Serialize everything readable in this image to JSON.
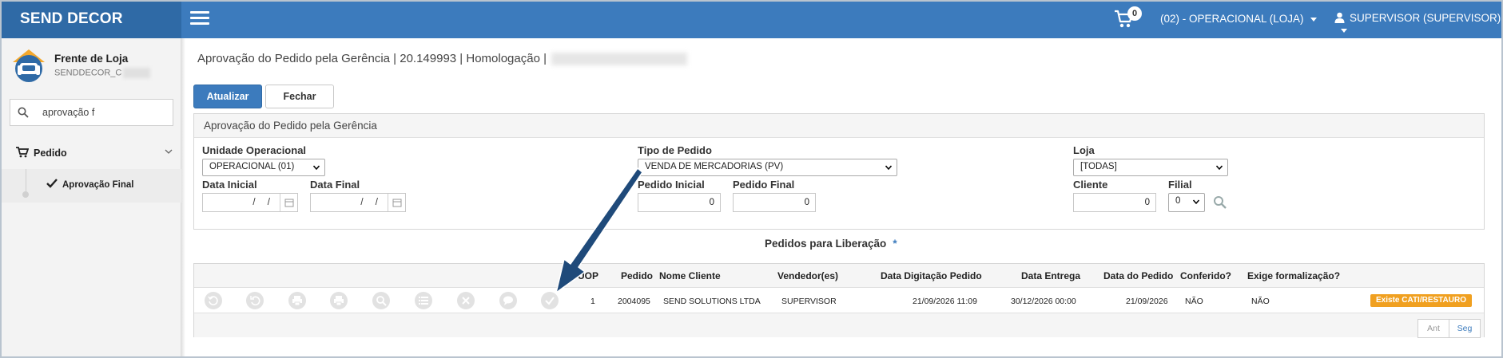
{
  "app": {
    "brand": "SEND DECOR"
  },
  "header": {
    "cart_count": "0",
    "store_selector": "(02) - OPERACIONAL (LOJA)",
    "user_menu": "SUPERVISOR (SUPERVISOR)"
  },
  "sidebar": {
    "profile_name": "Frente de Loja",
    "profile_sub": "SENDDECOR_C",
    "search_value": "aprovação f",
    "group_label": "Pedido",
    "item_label": "Aprovação Final"
  },
  "page": {
    "title": "Aprovação do Pedido pela Gerência | 20.149993 | Homologação |"
  },
  "toolbar": {
    "refresh_label": "Atualizar",
    "close_label": "Fechar"
  },
  "filters": {
    "panel_title": "Aprovação do Pedido pela Gerência",
    "unidade_label": "Unidade Operacional",
    "unidade_value": "OPERACIONAL (01)",
    "tipo_label": "Tipo de Pedido",
    "tipo_value": "VENDA DE MERCADORIAS (PV)",
    "loja_label": "Loja",
    "loja_value": "[TODAS]",
    "data_inicial_label": "Data Inicial",
    "data_inicial_value": "/ /",
    "data_final_label": "Data Final",
    "data_final_value": "/ /",
    "pedido_inicial_label": "Pedido Inicial",
    "pedido_inicial_value": "0",
    "pedido_final_label": "Pedido Final",
    "pedido_final_value": "0",
    "cliente_label": "Cliente",
    "cliente_value": "0",
    "filial_label": "Filial",
    "filial_value": "0"
  },
  "grid": {
    "title": "Pedidos para Liberação",
    "required_mark": "*",
    "columns": {
      "uop": "UOP",
      "pedido": "Pedido",
      "cliente": "Nome Cliente",
      "vendedor": "Vendedor(es)",
      "data_digitacao": "Data Digitação Pedido",
      "data_entrega": "Data Entrega",
      "data_pedido": "Data do Pedido",
      "conferido": "Conferido?",
      "formalizacao": "Exige formalização?"
    },
    "row": {
      "uop": "1",
      "pedido": "2004095",
      "cliente": "SEND SOLUTIONS LTDA",
      "vendedor": "SUPERVISOR",
      "data_digitacao": "21/09/2026 11:09",
      "data_entrega": "30/12/2026 00:00",
      "data_pedido": "21/09/2026",
      "conferido": "NÃO",
      "formalizacao": "NÃO",
      "status_badge": "Existe CATI/RESTAURO"
    },
    "pager_prev": "Ant",
    "pager_next": "Seg"
  },
  "colors": {
    "topbar": "#3c7bbd",
    "brand": "#2f6aa6",
    "primary_button": "#3c7bbd",
    "badge": "#f0a020",
    "annotation_arrow": "#1f4a7a"
  },
  "icons": [
    "hamburger-icon",
    "cart-icon",
    "user-icon",
    "search-icon",
    "cart-menu-icon",
    "chevron-down-icon",
    "check-icon",
    "calendar-icon",
    "magnifier-icon",
    "history-icon",
    "undo-icon",
    "print-icon",
    "print-alt-icon",
    "zoom-icon",
    "list-icon",
    "cancel-icon",
    "comment-icon",
    "approve-icon",
    "arrow-annotation"
  ]
}
